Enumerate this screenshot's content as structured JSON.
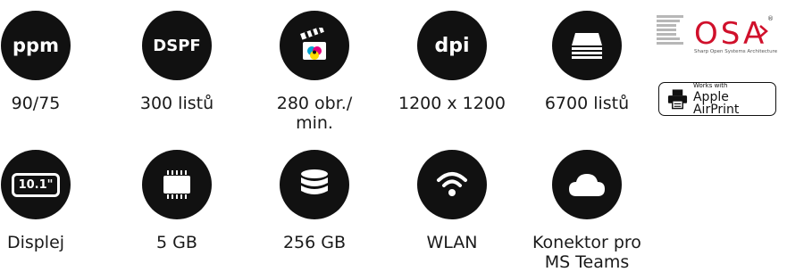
{
  "row1": [
    {
      "id": "ppm",
      "icon_text": "ppm",
      "label": "90/75"
    },
    {
      "id": "dspf",
      "icon_text": "DSPF",
      "label": "300 listů"
    },
    {
      "id": "speed",
      "icon": "clapperboard-cmyk-icon",
      "label": "280 obr./\nmin."
    },
    {
      "id": "dpi",
      "icon_text": "dpi",
      "label": "1200 x 1200"
    },
    {
      "id": "capacity",
      "icon": "paper-stack-icon",
      "label": "6700 listů"
    }
  ],
  "row2": [
    {
      "id": "display",
      "icon_text": "10.1\"",
      "label": "Displej"
    },
    {
      "id": "ram",
      "icon": "memory-chip-icon",
      "label": "5 GB"
    },
    {
      "id": "storage",
      "icon": "database-icon",
      "label": "256 GB"
    },
    {
      "id": "wlan",
      "icon": "wifi-icon",
      "label": "WLAN"
    },
    {
      "id": "teams",
      "icon": "cloud-icon",
      "label": "Konektor pro\nMS Teams"
    }
  ],
  "osa": {
    "logo_text": "OSA",
    "tagline": "Sharp Open Systems Architecture",
    "mark": "®"
  },
  "airprint": {
    "small": "Works with",
    "big": "Apple AirPrint"
  },
  "colors": {
    "circle": "#111111",
    "cyan": "#00a6d6",
    "magenta": "#e5007e",
    "yellow": "#ffdd00",
    "osa_red": "#d0102b",
    "osa_gray": "#b7b7b7"
  }
}
